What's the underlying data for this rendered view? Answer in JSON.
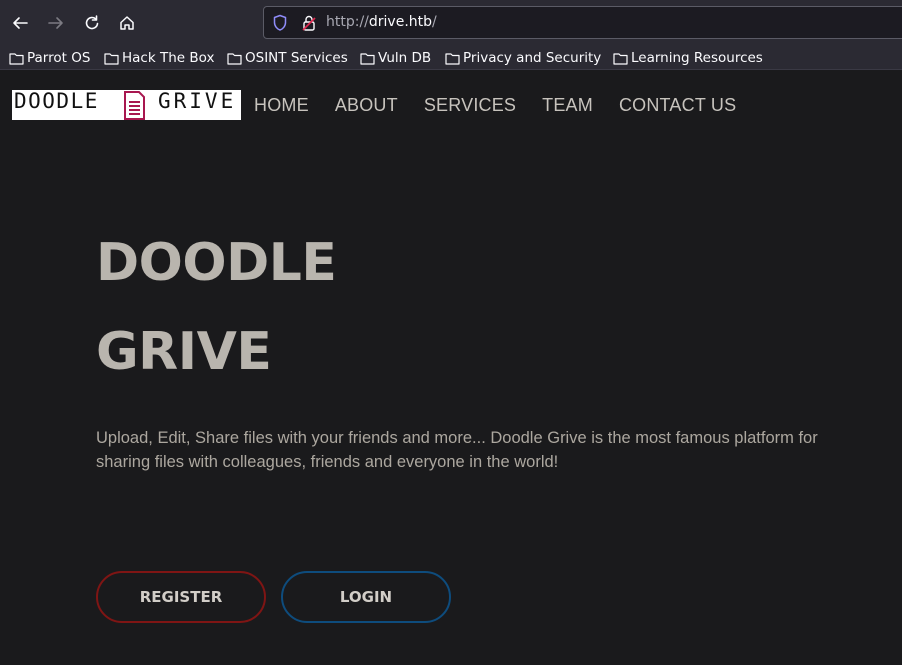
{
  "browser": {
    "url_scheme": "http://",
    "url_host": "drive.htb",
    "url_path": "/",
    "icons": [
      "back-arrow-icon",
      "forward-arrow-icon",
      "reload-icon",
      "home-icon",
      "shield-icon",
      "lock-icon",
      "folder-icon"
    ],
    "bookmarks": [
      {
        "label": "Parrot OS"
      },
      {
        "label": "Hack The Box"
      },
      {
        "label": "OSINT Services"
      },
      {
        "label": "Vuln DB"
      },
      {
        "label": "Privacy and Security"
      },
      {
        "label": "Learning Resources"
      }
    ]
  },
  "site": {
    "logo_text_left": "DOODLE",
    "logo_text_right": "GRIVE",
    "nav": [
      "HOME",
      "ABOUT",
      "SERVICES",
      "TEAM",
      "CONTACT US"
    ],
    "hero": {
      "title_line1": "DOODLE",
      "title_line2": "GRIVE",
      "description": "Upload, Edit, Share files with your friends and more... Doodle Grive is the most famous platform for sharing files with colleagues, friends and everyone in the world!"
    },
    "buttons": {
      "register": "REGISTER",
      "login": "LOGIN"
    }
  },
  "colors": {
    "page_bg": "#1a1a1c",
    "chrome_bg": "#2b2a33",
    "register_border": "#7f1514",
    "login_border": "#0e4c7d",
    "logo_accent": "#a8174f"
  }
}
